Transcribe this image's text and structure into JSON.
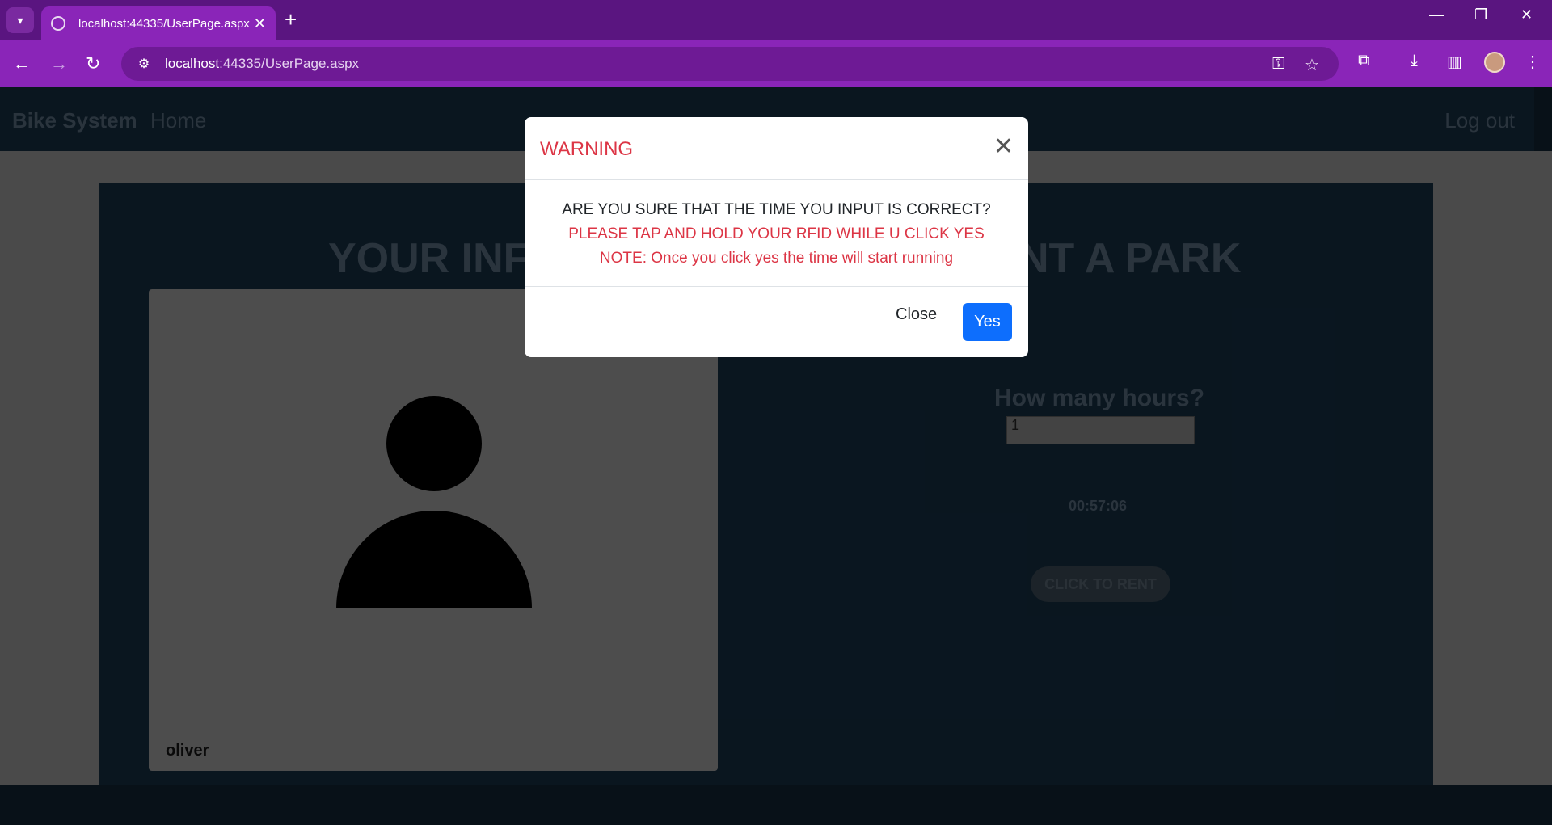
{
  "browser": {
    "tab_title": "localhost:44335/UserPage.aspx",
    "url_host": "localhost",
    "url_path": ":44335/UserPage.aspx"
  },
  "nav": {
    "brand": "Bike System",
    "home": "Home",
    "logout": "Log out"
  },
  "main": {
    "headline_left": "YOUR INFO",
    "headline_right": "NT A PARK",
    "username": "oliver",
    "hours_label": "How many hours?",
    "hours_value": "1",
    "timer": "00:57:06",
    "rent_button": "CLICK TO RENT"
  },
  "modal": {
    "title": "WARNING",
    "line1": "ARE YOU SURE THAT THE TIME YOU INPUT IS CORRECT?",
    "line2": "PLEASE TAP AND HOLD YOUR RFID WHILE U CLICK YES",
    "line3": "NOTE: Once you click yes the time will start running",
    "close_label": "Close",
    "yes_label": "Yes"
  }
}
